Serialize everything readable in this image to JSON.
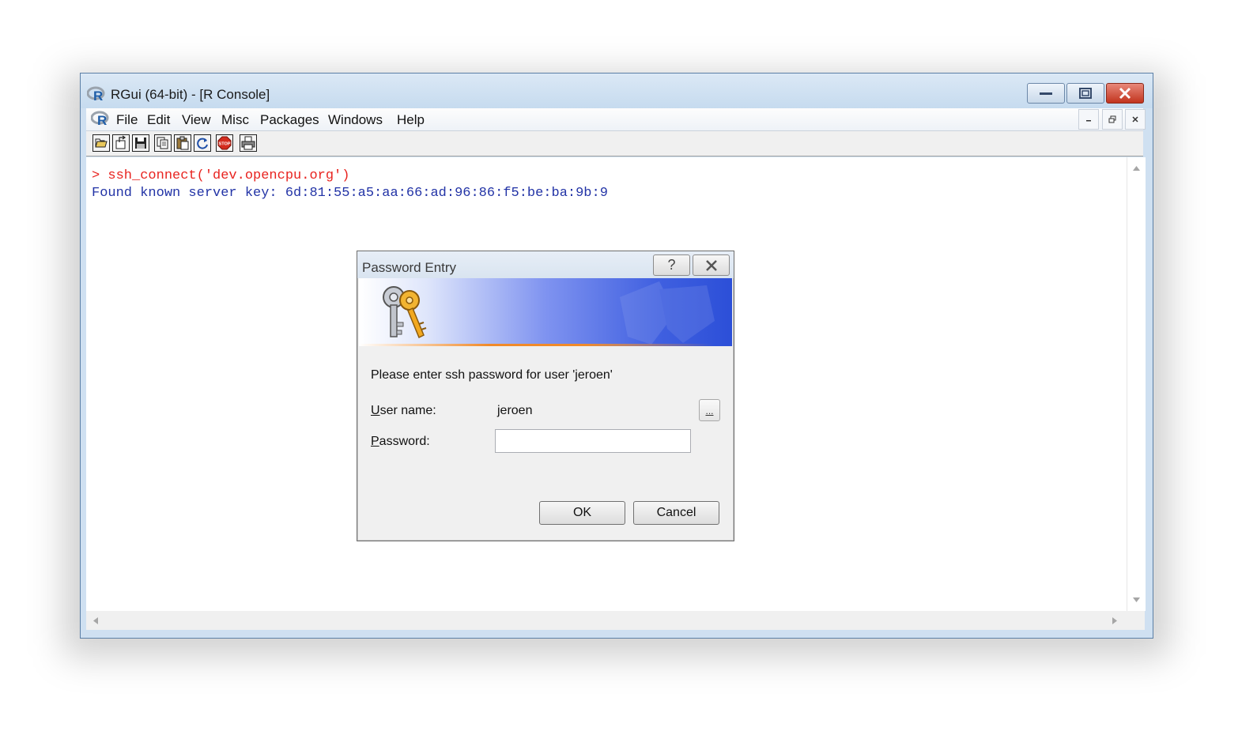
{
  "window": {
    "title": "RGui (64-bit) - [R Console]"
  },
  "menu": {
    "items": [
      "File",
      "Edit",
      "View",
      "Misc",
      "Packages",
      "Windows",
      "Help"
    ]
  },
  "toolbar": {
    "buttons": [
      "open-script",
      "load-workspace",
      "save-workspace",
      "copy",
      "paste",
      "copy-paste",
      "stop",
      "print"
    ]
  },
  "console": {
    "prompt_line": "> ssh_connect('dev.opencpu.org')",
    "output_line": "Found known server key: 6d:81:55:a5:aa:66:ad:96:86:f5:be:ba:9b:9"
  },
  "dialog": {
    "title": "Password Entry",
    "help_label": "?",
    "message": "Please enter ssh password for user 'jeroen'",
    "username_label_first": "U",
    "username_label_rest": "ser name:",
    "username_value": "jeroen",
    "password_label_first": "P",
    "password_label_rest": "assword:",
    "password_value": "",
    "browse_label": "...",
    "ok_label": "OK",
    "cancel_label": "Cancel"
  },
  "colors": {
    "prompt": "#e8231f",
    "output": "#2233a6",
    "titlebar": "#c6dbef",
    "close": "#c2341e"
  }
}
